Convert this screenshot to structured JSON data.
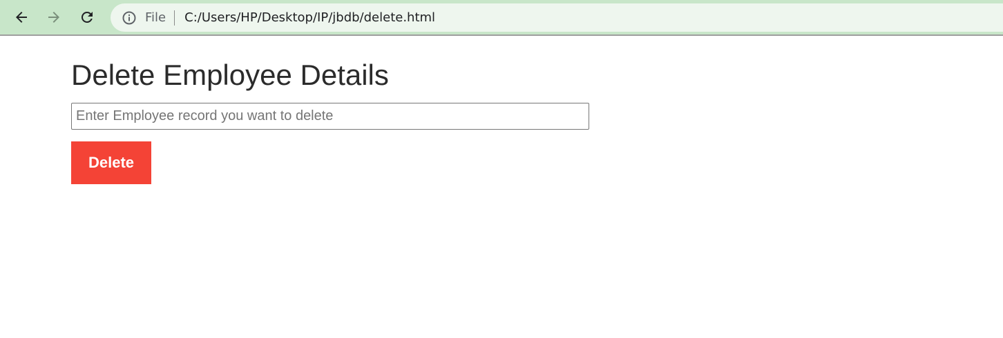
{
  "browser": {
    "scheme_label": "File",
    "url": "C:/Users/HP/Desktop/IP/jbdb/delete.html",
    "icons": {
      "back": "arrow-left-icon",
      "forward": "arrow-right-icon",
      "reload": "reload-icon",
      "info": "info-icon"
    },
    "toolbar_color": "#c8e6c9"
  },
  "page": {
    "title": "Delete Employee Details",
    "input": {
      "placeholder": "Enter Employee record you want to delete",
      "value": ""
    },
    "delete_button_label": "Delete",
    "delete_button_color": "#f44336"
  }
}
